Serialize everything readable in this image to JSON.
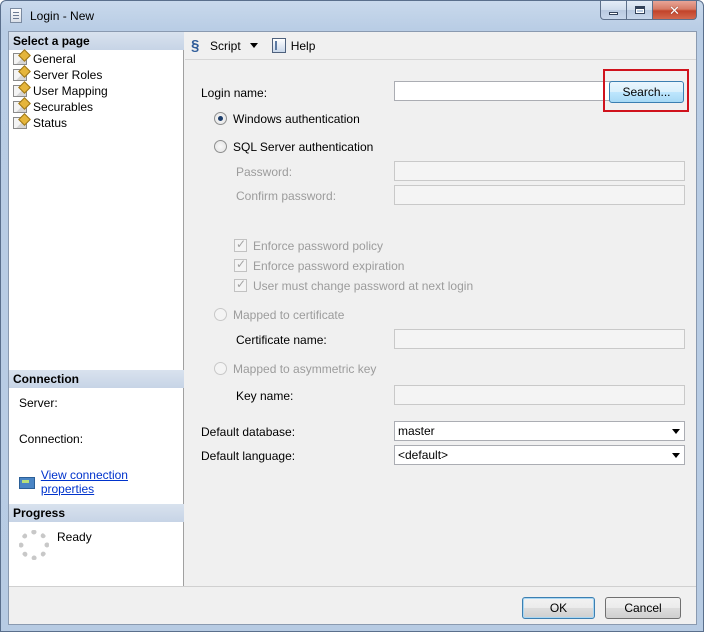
{
  "window": {
    "title": "Login - New",
    "icon": "document-icon",
    "controls": {
      "minimize": "minimize-icon",
      "maximize": "maximize-icon",
      "close": "close-icon"
    },
    "close_color": "#c2432a"
  },
  "sidebar": {
    "select_page_header": "Select a page",
    "pages": [
      {
        "label": "General",
        "icon": "page-icon"
      },
      {
        "label": "Server Roles",
        "icon": "page-icon"
      },
      {
        "label": "User Mapping",
        "icon": "page-icon"
      },
      {
        "label": "Securables",
        "icon": "page-icon"
      },
      {
        "label": "Status",
        "icon": "page-icon"
      }
    ],
    "connection_header": "Connection",
    "server_label": "Server:",
    "connection_label": "Connection:",
    "view_connection_link": "View connection properties",
    "progress_header": "Progress",
    "progress_status": "Ready"
  },
  "toolbar": {
    "script_label": "Script",
    "help_label": "Help"
  },
  "form": {
    "login_name_label": "Login name:",
    "login_name_value": "",
    "search_button": "Search...",
    "windows_auth": "Windows authentication",
    "sql_auth": "SQL Server authentication",
    "password_label": "Password:",
    "confirm_password_label": "Confirm password:",
    "enforce_policy": "Enforce password policy",
    "enforce_expiration": "Enforce password expiration",
    "must_change": "User must change password at next login",
    "mapped_cert": "Mapped to certificate",
    "cert_name_label": "Certificate name:",
    "mapped_asym": "Mapped to asymmetric key",
    "key_name_label": "Key name:",
    "default_db_label": "Default database:",
    "default_db_value": "master",
    "default_lang_label": "Default language:",
    "default_lang_value": "<default>",
    "selected_auth": "Windows authentication"
  },
  "footer": {
    "ok_button": "OK",
    "cancel_button": "Cancel"
  },
  "colors": {
    "highlight": "#d0121c",
    "link": "#0033cc",
    "accent": "#3c7fb1"
  }
}
